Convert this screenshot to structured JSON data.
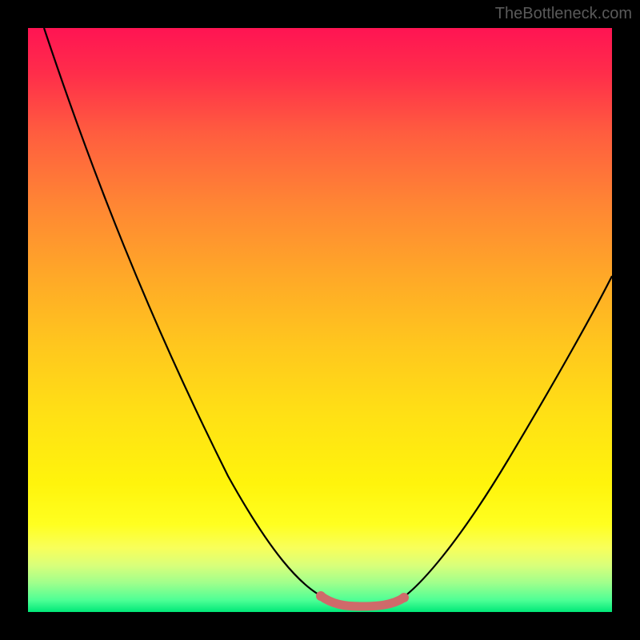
{
  "watermark": "TheBottleneck.com",
  "chart_data": {
    "type": "line",
    "title": "",
    "xlabel": "",
    "ylabel": "",
    "x": [
      0.0,
      0.05,
      0.1,
      0.15,
      0.2,
      0.25,
      0.3,
      0.35,
      0.4,
      0.45,
      0.5,
      0.53,
      0.56,
      0.59,
      0.62,
      0.65,
      0.7,
      0.75,
      0.8,
      0.85,
      0.9,
      0.95,
      1.0
    ],
    "values": [
      1.0,
      0.92,
      0.82,
      0.72,
      0.62,
      0.52,
      0.42,
      0.33,
      0.24,
      0.16,
      0.08,
      0.03,
      0.01,
      0.0,
      0.0,
      0.01,
      0.05,
      0.12,
      0.21,
      0.3,
      0.39,
      0.47,
      0.55
    ],
    "ylim": [
      0,
      1
    ],
    "xlim": [
      0,
      1
    ],
    "highlight_segment": {
      "x_start": 0.5,
      "x_end": 0.65,
      "color": "#d87070"
    },
    "background_gradient": {
      "top": "#ff1453",
      "mid": "#ffe015",
      "bottom": "#00e878"
    }
  }
}
